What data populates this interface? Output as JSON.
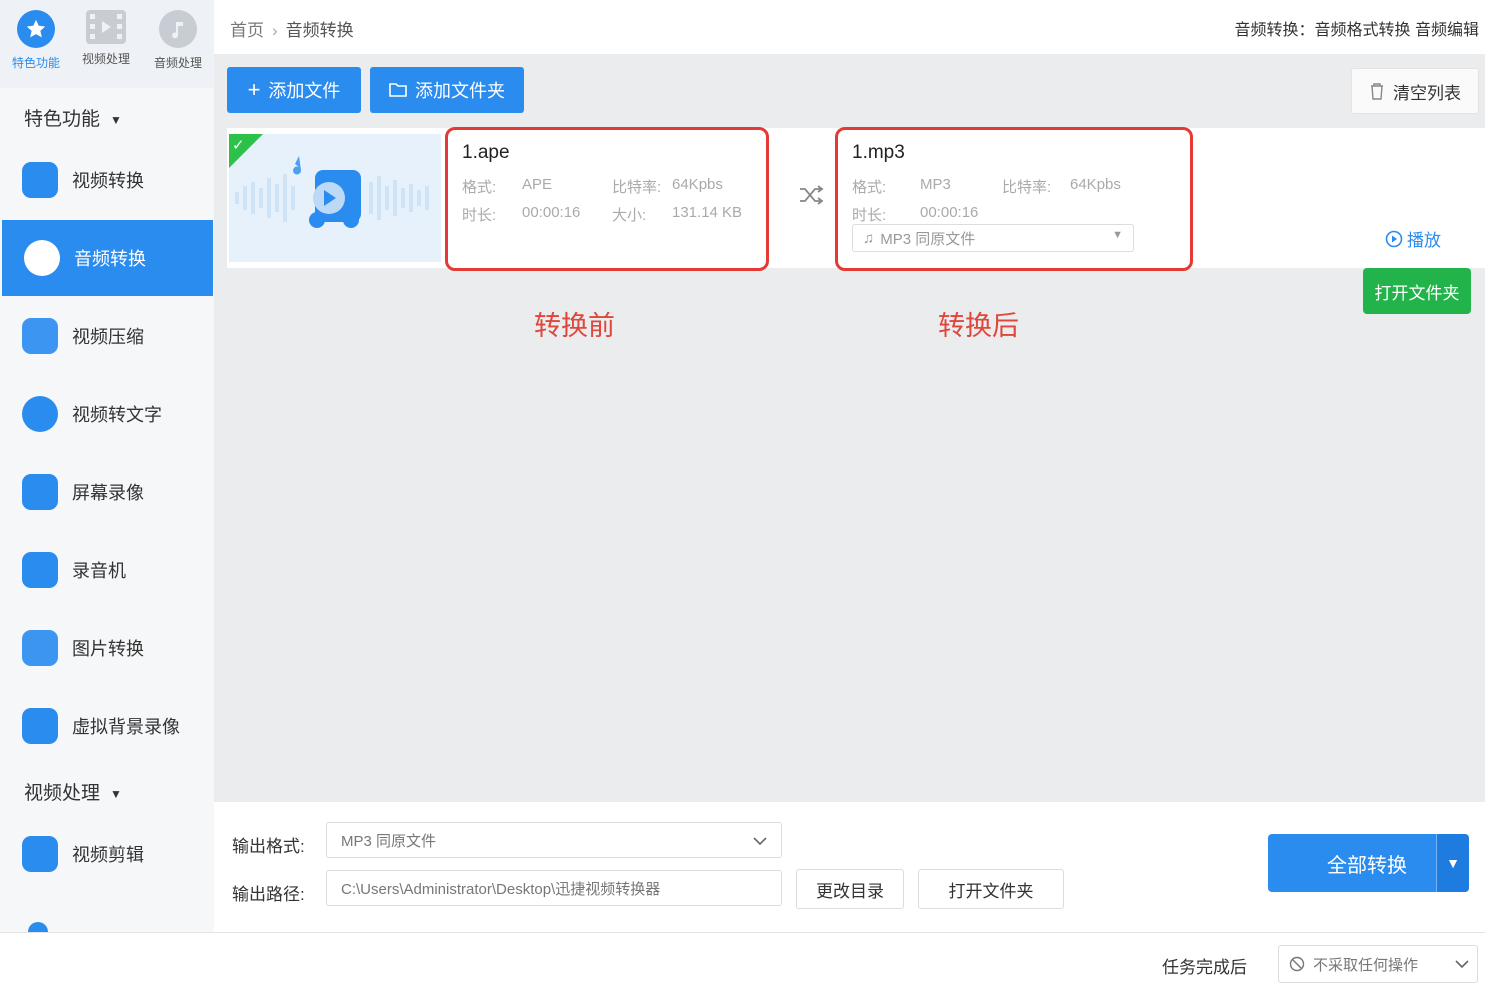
{
  "topcats": [
    {
      "label": "特色功能",
      "icon": "star-icon",
      "active": true
    },
    {
      "label": "视频处理",
      "icon": "film-icon",
      "active": false
    },
    {
      "label": "音频处理",
      "icon": "audio-icon",
      "active": false
    }
  ],
  "sidebar": {
    "section1": "特色功能",
    "section2": "视频处理",
    "items": [
      {
        "label": "视频转换",
        "icon": "video-convert-icon"
      },
      {
        "label": "音频转换",
        "icon": "audio-convert-icon"
      },
      {
        "label": "视频压缩",
        "icon": "video-compress-icon"
      },
      {
        "label": "视频转文字",
        "icon": "video-to-text-icon"
      },
      {
        "label": "屏幕录像",
        "icon": "screen-record-icon"
      },
      {
        "label": "录音机",
        "icon": "recorder-icon"
      },
      {
        "label": "图片转换",
        "icon": "image-convert-icon"
      },
      {
        "label": "虚拟背景录像",
        "icon": "virtual-bg-icon"
      }
    ],
    "items2": [
      {
        "label": "视频剪辑",
        "icon": "video-edit-icon"
      }
    ]
  },
  "breadcrumb": {
    "home": "首页",
    "current": "音频转换"
  },
  "topright": "音频转换：音频格式转换 音频编辑",
  "toolbar": {
    "add_file": "添加文件",
    "add_folder": "添加文件夹",
    "clear_list": "清空列表"
  },
  "source": {
    "name": "1.ape",
    "format_label": "格式:",
    "format": "APE",
    "bitrate_label": "比特率:",
    "bitrate": "64Kpbs",
    "duration_label": "时长:",
    "duration": "00:00:16",
    "size_label": "大小:",
    "size": "131.14 KB"
  },
  "target": {
    "name": "1.mp3",
    "format_label": "格式:",
    "format": "MP3",
    "bitrate_label": "比特率:",
    "bitrate": "64Kpbs",
    "duration_label": "时长:",
    "duration": "00:00:16",
    "select_value": "MP3  同原文件"
  },
  "actions": {
    "play": "播放",
    "open_folder": "打开文件夹"
  },
  "annotations": {
    "before": "转换前",
    "after": "转换后"
  },
  "output": {
    "format_label": "输出格式:",
    "format_value": "MP3  同原文件",
    "path_label": "输出路径:",
    "path_value": "C:\\Users\\Administrator\\Desktop\\迅捷视频转换器",
    "change_dir": "更改目录",
    "open_folder": "打开文件夹",
    "convert_all": "全部转换"
  },
  "footer": {
    "after_task_label": "任务完成后",
    "after_task_value": "不采取任何操作"
  },
  "colors": {
    "accent": "#2b8cf0",
    "green": "#22b44b",
    "annotation_red": "#e53935"
  }
}
